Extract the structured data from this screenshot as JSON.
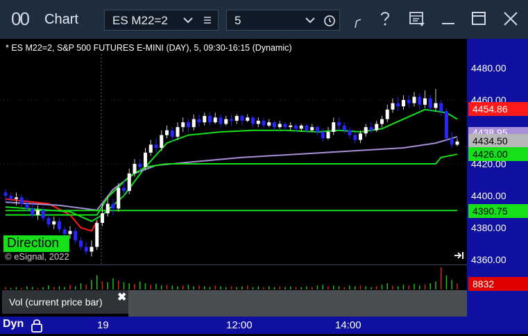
{
  "window": {
    "icon": "00",
    "title": "Chart",
    "symbol": "ES M22=2",
    "interval": "5"
  },
  "icons": {
    "symbol_dropdown": "chevron-down-icon",
    "symbol_list": "list-icon",
    "interval_dropdown": "chevron-down-icon",
    "interval_clock": "clock-icon",
    "draw_tool": "pen-icon",
    "help": "help-icon",
    "template": "template-icon",
    "minimize": "minimize-icon",
    "maximize": "maximize-icon",
    "close": "close-icon"
  },
  "chart": {
    "title": "* ES M22=2, S&P 500 FUTURES E-MINI (DAY), 5, 09:30-16:15 (Dynamic)",
    "copyright": "© eSignal, 2022",
    "direction_label": "Direction",
    "price_ticks": [
      "4480.00",
      "4460.00",
      "4440.00",
      "4420.00",
      "4400.00",
      "4380.00",
      "4360.00"
    ],
    "time_ticks": [
      "19",
      "12:00",
      "14:00"
    ],
    "tags": {
      "last": "4454.86",
      "mid": "4434.50",
      "mid_upper_partial": "4438.95",
      "green_upper": "4426.00",
      "green_lower": "4390.75",
      "volume": "8832"
    }
  },
  "volume_panel": {
    "label": "Vol (current price bar)"
  },
  "bottombar": {
    "mode": "Dyn"
  },
  "colors": {
    "titlebar": "#1e2d3d",
    "axis_bg": "#0f0fa0",
    "up_candle": "#ffffff",
    "down_candle": "#2626ff",
    "green_line": "#15e01a",
    "red_line": "#ff1a1a",
    "purple_line": "#a88fd8",
    "last_tag": "#ff1a1a",
    "mid_tag": "#b8b8b8",
    "green_tag": "#15e01a"
  },
  "chart_data": {
    "type": "candlestick",
    "title": "* ES M22=2, S&P 500 FUTURES E-MINI (DAY), 5, 09:30-16:15 (Dynamic)",
    "ylim": [
      4360,
      4486
    ],
    "y_ticks": [
      4360,
      4380,
      4400,
      4420,
      4440,
      4460,
      4480
    ],
    "x_ticks": [
      "19",
      "12:00",
      "14:00"
    ],
    "grid": false,
    "candles": [
      [
        4402,
        4400,
        4404,
        4396
      ],
      [
        4400,
        4398,
        4402,
        4395
      ],
      [
        4398,
        4399,
        4402,
        4394
      ],
      [
        4399,
        4395,
        4401,
        4393
      ],
      [
        4395,
        4392,
        4398,
        4390
      ],
      [
        4392,
        4388,
        4395,
        4386
      ],
      [
        4388,
        4391,
        4394,
        4385
      ],
      [
        4391,
        4386,
        4393,
        4384
      ],
      [
        4386,
        4382,
        4389,
        4380
      ],
      [
        4382,
        4384,
        4387,
        4379
      ],
      [
        4384,
        4379,
        4386,
        4377
      ],
      [
        4379,
        4376,
        4381,
        4374
      ],
      [
        4376,
        4378,
        4381,
        4373
      ],
      [
        4378,
        4372,
        4380,
        4370
      ],
      [
        4372,
        4368,
        4374,
        4366
      ],
      [
        4368,
        4365,
        4371,
        4363
      ],
      [
        4365,
        4368,
        4372,
        4362
      ],
      [
        4368,
        4383,
        4385,
        4366
      ],
      [
        4383,
        4389,
        4395,
        4381
      ],
      [
        4389,
        4395,
        4400,
        4387
      ],
      [
        4395,
        4392,
        4398,
        4388
      ],
      [
        4392,
        4405,
        4408,
        4390
      ],
      [
        4405,
        4403,
        4410,
        4400
      ],
      [
        4403,
        4414,
        4417,
        4401
      ],
      [
        4414,
        4420,
        4423,
        4412
      ],
      [
        4420,
        4418,
        4423,
        4415
      ],
      [
        4418,
        4427,
        4430,
        4416
      ],
      [
        4427,
        4432,
        4435,
        4425
      ],
      [
        4432,
        4430,
        4436,
        4427
      ],
      [
        4430,
        4438,
        4441,
        4428
      ],
      [
        4438,
        4441,
        4444,
        4436
      ],
      [
        4441,
        4437,
        4443,
        4434
      ],
      [
        4437,
        4443,
        4446,
        4435
      ],
      [
        4443,
        4446,
        4449,
        4440
      ],
      [
        4446,
        4443,
        4448,
        4440
      ],
      [
        4443,
        4448,
        4451,
        4441
      ],
      [
        4448,
        4446,
        4451,
        4443
      ],
      [
        4446,
        4450,
        4452,
        4444
      ],
      [
        4450,
        4446,
        4452,
        4444
      ],
      [
        4446,
        4449,
        4452,
        4445
      ],
      [
        4449,
        4445,
        4451,
        4443
      ],
      [
        4445,
        4448,
        4450,
        4444
      ],
      [
        4448,
        4447,
        4451,
        4444
      ],
      [
        4447,
        4450,
        4451,
        4445
      ],
      [
        4450,
        4447,
        4451,
        4444
      ],
      [
        4447,
        4449,
        4451,
        4446
      ],
      [
        4449,
        4445,
        4450,
        4443
      ],
      [
        4445,
        4447,
        4449,
        4443
      ],
      [
        4447,
        4444,
        4449,
        4442
      ],
      [
        4444,
        4446,
        4448,
        4443
      ],
      [
        4446,
        4443,
        4447,
        4441
      ],
      [
        4443,
        4445,
        4447,
        4442
      ],
      [
        4445,
        4443,
        4446,
        4441
      ],
      [
        4443,
        4444,
        4446,
        4441
      ],
      [
        4444,
        4442,
        4445,
        4440
      ],
      [
        4442,
        4444,
        4445,
        4440
      ],
      [
        4444,
        4441,
        4445,
        4439
      ],
      [
        4441,
        4443,
        4445,
        4440
      ],
      [
        4443,
        4440,
        4444,
        4438
      ],
      [
        4440,
        4436,
        4442,
        4434
      ],
      [
        4436,
        4440,
        4443,
        4435
      ],
      [
        4440,
        4446,
        4449,
        4438
      ],
      [
        4446,
        4444,
        4449,
        4441
      ],
      [
        4444,
        4441,
        4446,
        4439
      ],
      [
        4441,
        4438,
        4443,
        4436
      ],
      [
        4438,
        4435,
        4440,
        4433
      ],
      [
        4435,
        4439,
        4441,
        4433
      ],
      [
        4439,
        4443,
        4445,
        4437
      ],
      [
        4443,
        4441,
        4446,
        4439
      ],
      [
        4441,
        4445,
        4447,
        4440
      ],
      [
        4445,
        4448,
        4450,
        4443
      ],
      [
        4448,
        4454,
        4457,
        4446
      ],
      [
        4454,
        4458,
        4461,
        4452
      ],
      [
        4458,
        4456,
        4462,
        4453
      ],
      [
        4456,
        4460,
        4463,
        4454
      ],
      [
        4460,
        4458,
        4463,
        4455
      ],
      [
        4458,
        4462,
        4465,
        4456
      ],
      [
        4462,
        4457,
        4464,
        4454
      ],
      [
        4457,
        4461,
        4466,
        4455
      ],
      [
        4461,
        4455,
        4463,
        4452
      ],
      [
        4455,
        4458,
        4467,
        4453
      ],
      [
        4458,
        4453,
        4460,
        4450
      ],
      [
        4453,
        4436,
        4455,
        4434
      ],
      [
        4436,
        4432,
        4440,
        4430
      ],
      [
        4432,
        4434,
        4436,
        4431
      ]
    ],
    "series": [
      {
        "name": "Direction",
        "color": "#ff1a1a",
        "x": [
          0,
          8,
          12,
          14,
          16,
          17
        ],
        "y": [
          4398,
          4395,
          4388,
          4380,
          4378,
          4384
        ]
      },
      {
        "color": "#15e01a",
        "x": [
          0,
          12,
          16,
          18,
          22,
          26,
          30,
          34,
          40,
          46,
          52,
          58,
          62,
          66,
          70,
          74,
          78,
          82,
          84
        ],
        "y": [
          4393,
          4390,
          4384,
          4388,
          4400,
          4418,
          4433,
          4438,
          4440,
          4441,
          4441,
          4440,
          4441,
          4440,
          4442,
          4448,
          4454,
          4452,
          4448
        ]
      },
      {
        "color": "#a88fd8",
        "x": [
          0,
          10,
          17,
          20,
          24,
          28,
          34,
          44,
          54,
          64,
          74,
          80,
          84
        ],
        "y": [
          4396,
          4394,
          4391,
          4404,
          4414,
          4419,
          4421,
          4424,
          4426,
          4428,
          4430,
          4433,
          4437
        ]
      },
      {
        "color": "#15e01a",
        "x": [
          0,
          17,
          19,
          23,
          26,
          30,
          80,
          81,
          84
        ],
        "y": [
          4388,
          4388,
          4399,
          4412,
          4418,
          4420,
          4420,
          4424,
          4426
        ]
      },
      {
        "color": "#15e01a",
        "x": [
          0,
          84
        ],
        "y": [
          4390.75,
          4390.75
        ]
      }
    ],
    "volume": {
      "last": 8832,
      "values": [
        3,
        2,
        3,
        2,
        4,
        3,
        2,
        3,
        5,
        3,
        4,
        3,
        6,
        4,
        8,
        6,
        12,
        18,
        10,
        9,
        14,
        11,
        9,
        8,
        7,
        10,
        8,
        6,
        7,
        5,
        6,
        5,
        4,
        5,
        6,
        4,
        5,
        4,
        3,
        5,
        4,
        3,
        4,
        3,
        4,
        5,
        3,
        4,
        3,
        4,
        3,
        4,
        3,
        4,
        3,
        3,
        4,
        3,
        5,
        6,
        4,
        5,
        4,
        3,
        5,
        4,
        5,
        4,
        3,
        4,
        6,
        8,
        5,
        4,
        6,
        5,
        7,
        5,
        6,
        8,
        10,
        28,
        18,
        12,
        8
      ]
    }
  }
}
